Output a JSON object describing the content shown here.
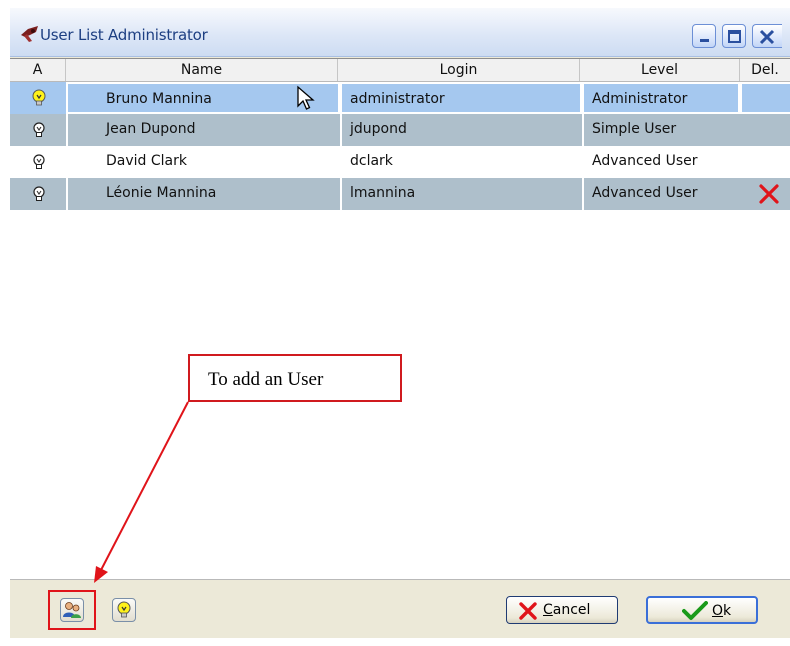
{
  "window": {
    "title": "User List Administrator"
  },
  "table": {
    "columns": [
      "A",
      "Name",
      "Login",
      "Level",
      "Del."
    ],
    "rows": [
      {
        "active": true,
        "name": "Bruno Mannina",
        "login": "administrator",
        "level": "Administrator",
        "deleted": false
      },
      {
        "active": false,
        "name": "Jean Dupond",
        "login": "jdupond",
        "level": "Simple User",
        "deleted": false
      },
      {
        "active": false,
        "name": "David Clark",
        "login": "dclark",
        "level": "Advanced User",
        "deleted": false
      },
      {
        "active": false,
        "name": "Léonie Mannina",
        "login": "lmannina",
        "level": "Advanced User",
        "deleted": true
      }
    ]
  },
  "buttons": {
    "cancel_prefix": "",
    "cancel_mnemonic": "C",
    "cancel_rest": "ancel",
    "ok_mnemonic": "O",
    "ok_rest": "k"
  },
  "callout": {
    "text": "To add an User"
  },
  "icons": {
    "app": "app-icon",
    "minimize": "minimize-icon",
    "maximize": "maximize-icon",
    "close": "close-icon",
    "active_bulb": "lightbulb-on-icon",
    "inactive_bulb": "lightbulb-off-icon",
    "delete": "red-x-icon",
    "add_user": "add-user-icon",
    "activate": "lightbulb-icon",
    "cancel": "red-x-icon",
    "ok": "green-check-icon",
    "cursor": "mouse-cursor-icon"
  },
  "colors": {
    "selected_row": "#a5c8ef",
    "alt_row": "#aebfcb",
    "callout_border": "#d01a1f",
    "delete_mark": "#e0141a",
    "ok_check": "#1a9a1a"
  }
}
